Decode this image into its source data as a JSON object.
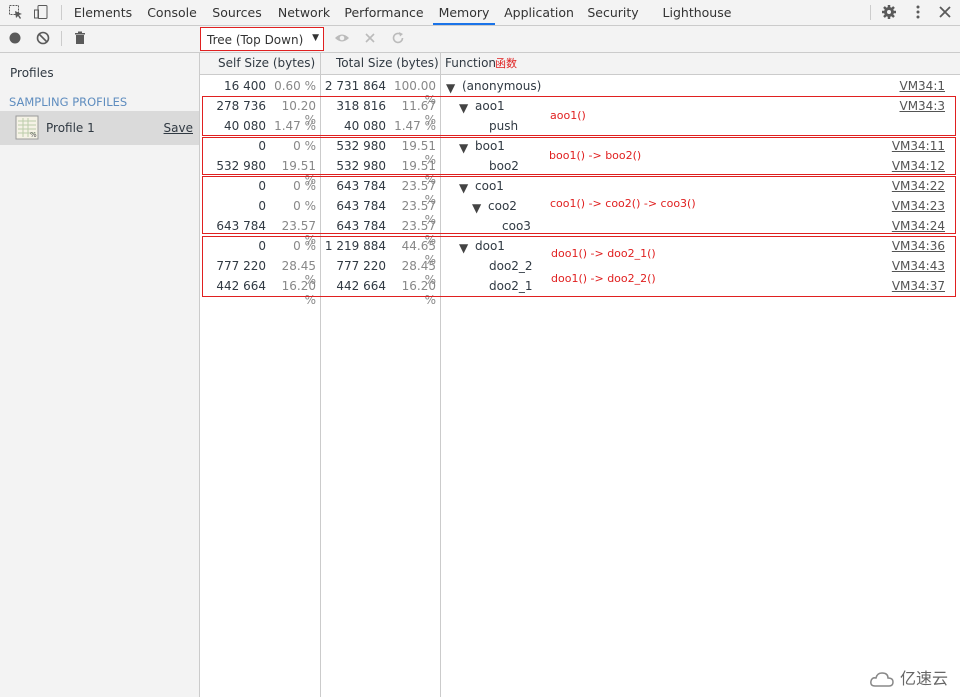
{
  "tabs": [
    {
      "label": "Elements"
    },
    {
      "label": "Console"
    },
    {
      "label": "Sources"
    },
    {
      "label": "Network"
    },
    {
      "label": "Performance"
    },
    {
      "label": "Memory"
    },
    {
      "label": "Application"
    },
    {
      "label": "Security"
    },
    {
      "label": "Lighthouse"
    }
  ],
  "active_tab": "Memory",
  "icons": [
    "inspect-icon",
    "device-toggle-icon",
    "record-icon",
    "clear-icon",
    "trash-icon",
    "eye-icon",
    "close-icon",
    "reload-icon",
    "gear-icon",
    "more-icon",
    "close-devtools-icon"
  ],
  "toolbar": {
    "view_select": "Tree (Top Down)"
  },
  "sidebar": {
    "heading": "Profiles",
    "section": "SAMPLING PROFILES",
    "profile_name": "Profile 1",
    "save_label": "Save"
  },
  "columns": {
    "self": "Self Size (bytes)",
    "total": "Total Size (bytes)",
    "function": "Function",
    "function_note": "函数"
  },
  "rows": [
    {
      "self": "16 400",
      "self_pct": "0.60 %",
      "total": "2 731 864",
      "total_pct": "100.00 %",
      "fn": "(anonymous)",
      "link": "VM34:1",
      "expander": "▼"
    },
    {
      "self": "278 736",
      "self_pct": "10.20 %",
      "total": "318 816",
      "total_pct": "11.67 %",
      "fn": "aoo1",
      "link": "VM34:3",
      "expander": "▼"
    },
    {
      "self": "40 080",
      "self_pct": "1.47 %",
      "total": "40 080",
      "total_pct": "1.47 %",
      "fn": "push",
      "link": "",
      "expander": ""
    },
    {
      "self": "0",
      "self_pct": "0 %",
      "total": "532 980",
      "total_pct": "19.51 %",
      "fn": "boo1",
      "link": "VM34:11",
      "expander": "▼"
    },
    {
      "self": "532 980",
      "self_pct": "19.51 %",
      "total": "532 980",
      "total_pct": "19.51 %",
      "fn": "boo2",
      "link": "VM34:12",
      "expander": ""
    },
    {
      "self": "0",
      "self_pct": "0 %",
      "total": "643 784",
      "total_pct": "23.57 %",
      "fn": "coo1",
      "link": "VM34:22",
      "expander": "▼"
    },
    {
      "self": "0",
      "self_pct": "0 %",
      "total": "643 784",
      "total_pct": "23.57 %",
      "fn": "coo2",
      "link": "VM34:23",
      "expander": "▼"
    },
    {
      "self": "643 784",
      "self_pct": "23.57 %",
      "total": "643 784",
      "total_pct": "23.57 %",
      "fn": "coo3",
      "link": "VM34:24",
      "expander": ""
    },
    {
      "self": "0",
      "self_pct": "0 %",
      "total": "1 219 884",
      "total_pct": "44.65 %",
      "fn": "doo1",
      "link": "VM34:36",
      "expander": "▼"
    },
    {
      "self": "777 220",
      "self_pct": "28.45 %",
      "total": "777 220",
      "total_pct": "28.45 %",
      "fn": "doo2_2",
      "link": "VM34:43",
      "expander": ""
    },
    {
      "self": "442 664",
      "self_pct": "16.20 %",
      "total": "442 664",
      "total_pct": "16.20 %",
      "fn": "doo2_1",
      "link": "VM34:37",
      "expander": ""
    }
  ],
  "annotations": [
    "aoo1()",
    "boo1() -> boo2()",
    "coo1() -> coo2() -> coo3()",
    "doo1() -> doo2_1()",
    "doo1() -> doo2_2()"
  ],
  "watermark": "亿速云",
  "colors": {
    "accent": "#1a73e8",
    "annotation_red": "#e02020"
  }
}
